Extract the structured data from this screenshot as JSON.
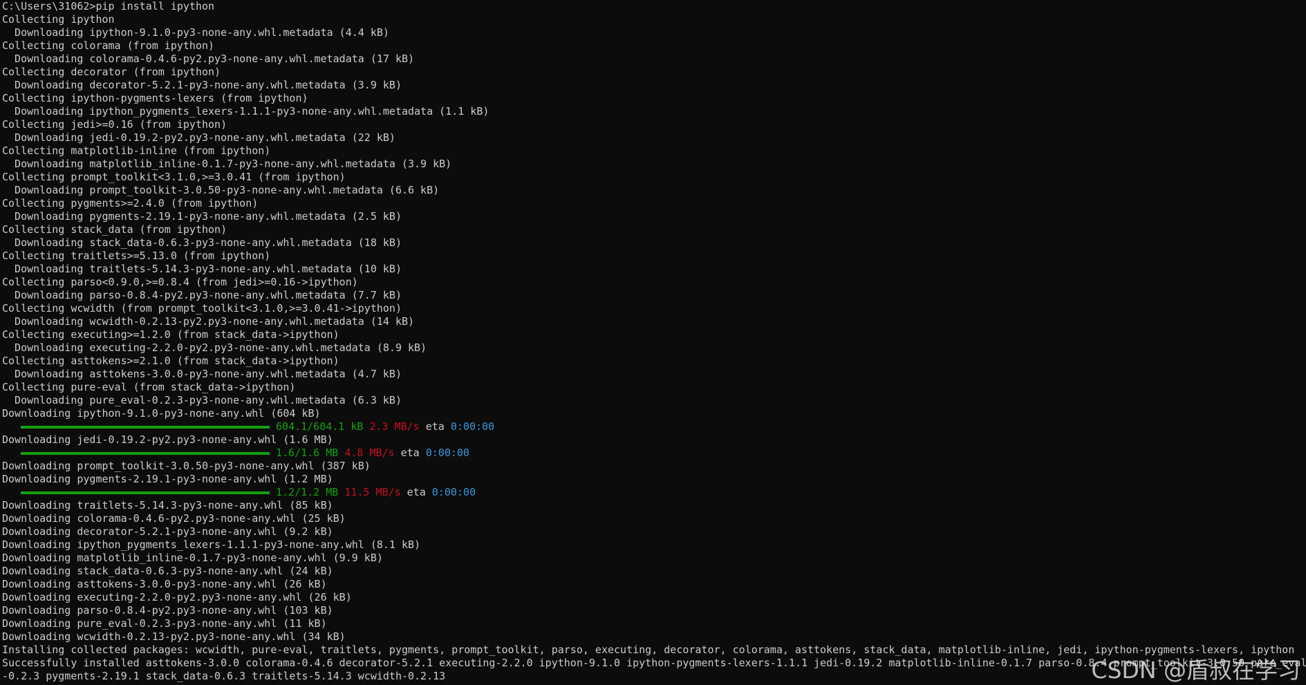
{
  "lines": [
    "C:\\Users\\31062>pip install ipython",
    "Collecting ipython",
    "  Downloading ipython-9.1.0-py3-none-any.whl.metadata (4.4 kB)",
    "Collecting colorama (from ipython)",
    "  Downloading colorama-0.4.6-py2.py3-none-any.whl.metadata (17 kB)",
    "Collecting decorator (from ipython)",
    "  Downloading decorator-5.2.1-py3-none-any.whl.metadata (3.9 kB)",
    "Collecting ipython-pygments-lexers (from ipython)",
    "  Downloading ipython_pygments_lexers-1.1.1-py3-none-any.whl.metadata (1.1 kB)",
    "Collecting jedi>=0.16 (from ipython)",
    "  Downloading jedi-0.19.2-py2.py3-none-any.whl.metadata (22 kB)",
    "Collecting matplotlib-inline (from ipython)",
    "  Downloading matplotlib_inline-0.1.7-py3-none-any.whl.metadata (3.9 kB)",
    "Collecting prompt_toolkit<3.1.0,>=3.0.41 (from ipython)",
    "  Downloading prompt_toolkit-3.0.50-py3-none-any.whl.metadata (6.6 kB)",
    "Collecting pygments>=2.4.0 (from ipython)",
    "  Downloading pygments-2.19.1-py3-none-any.whl.metadata (2.5 kB)",
    "Collecting stack_data (from ipython)",
    "  Downloading stack_data-0.6.3-py3-none-any.whl.metadata (18 kB)",
    "Collecting traitlets>=5.13.0 (from ipython)",
    "  Downloading traitlets-5.14.3-py3-none-any.whl.metadata (10 kB)",
    "Collecting parso<0.9.0,>=0.8.4 (from jedi>=0.16->ipython)",
    "  Downloading parso-0.8.4-py2.py3-none-any.whl.metadata (7.7 kB)",
    "Collecting wcwidth (from prompt_toolkit<3.1.0,>=3.0.41->ipython)",
    "  Downloading wcwidth-0.2.13-py2.py3-none-any.whl.metadata (14 kB)",
    "Collecting executing>=1.2.0 (from stack_data->ipython)",
    "  Downloading executing-2.2.0-py2.py3-none-any.whl.metadata (8.9 kB)",
    "Collecting asttokens>=2.1.0 (from stack_data->ipython)",
    "  Downloading asttokens-3.0.0-py3-none-any.whl.metadata (4.7 kB)",
    "Collecting pure-eval (from stack_data->ipython)",
    "  Downloading pure_eval-0.2.3-py3-none-any.whl.metadata (6.3 kB)",
    "Downloading ipython-9.1.0-py3-none-any.whl (604 kB)"
  ],
  "progress": [
    {
      "size": "604.1/604.1 kB",
      "speed": "2.3 MB/s",
      "eta_label": "eta",
      "eta": "0:00:00",
      "fraction": 1.0
    },
    {
      "size": "1.6/1.6 MB",
      "speed": "4.8 MB/s",
      "eta_label": "eta",
      "eta": "0:00:00",
      "fraction": 1.0
    },
    {
      "size": "1.2/1.2 MB",
      "speed": "11.5 MB/s",
      "eta_label": "eta",
      "eta": "0:00:00",
      "fraction": 1.0
    }
  ],
  "after_progress_1": [
    "Downloading jedi-0.19.2-py2.py3-none-any.whl (1.6 MB)"
  ],
  "after_progress_2": [
    "Downloading prompt_toolkit-3.0.50-py3-none-any.whl (387 kB)",
    "Downloading pygments-2.19.1-py3-none-any.whl (1.2 MB)"
  ],
  "after_progress_3": [
    "Downloading traitlets-5.14.3-py3-none-any.whl (85 kB)",
    "Downloading colorama-0.4.6-py2.py3-none-any.whl (25 kB)",
    "Downloading decorator-5.2.1-py3-none-any.whl (9.2 kB)",
    "Downloading ipython_pygments_lexers-1.1.1-py3-none-any.whl (8.1 kB)",
    "Downloading matplotlib_inline-0.1.7-py3-none-any.whl (9.9 kB)",
    "Downloading stack_data-0.6.3-py3-none-any.whl (24 kB)",
    "Downloading asttokens-3.0.0-py3-none-any.whl (26 kB)",
    "Downloading executing-2.2.0-py2.py3-none-any.whl (26 kB)",
    "Downloading parso-0.8.4-py2.py3-none-any.whl (103 kB)",
    "Downloading pure_eval-0.2.3-py3-none-any.whl (11 kB)",
    "Downloading wcwidth-0.2.13-py2.py3-none-any.whl (34 kB)",
    "Installing collected packages: wcwidth, pure-eval, traitlets, pygments, prompt_toolkit, parso, executing, decorator, colorama, asttokens, stack_data, matplotlib-inline, jedi, ipython-pygments-lexers, ipython",
    "Successfully installed asttokens-3.0.0 colorama-0.4.6 decorator-5.2.1 executing-2.2.0 ipython-9.1.0 ipython-pygments-lexers-1.1.1 jedi-0.19.2 matplotlib-inline-0.1.7 parso-0.8.4 prompt_toolkit-3.0.50 pure_eval",
    "-0.2.3 pygments-2.19.1 stack_data-0.6.3 traitlets-5.14.3 wcwidth-0.2.13"
  ],
  "colors": {
    "background": "#0c0c0c",
    "text": "#cccccc",
    "progress_green": "#13a10e",
    "speed_red": "#c50f1f",
    "eta_blue": "#3a96dd"
  },
  "watermark": "CSDN @盾叔在学习"
}
